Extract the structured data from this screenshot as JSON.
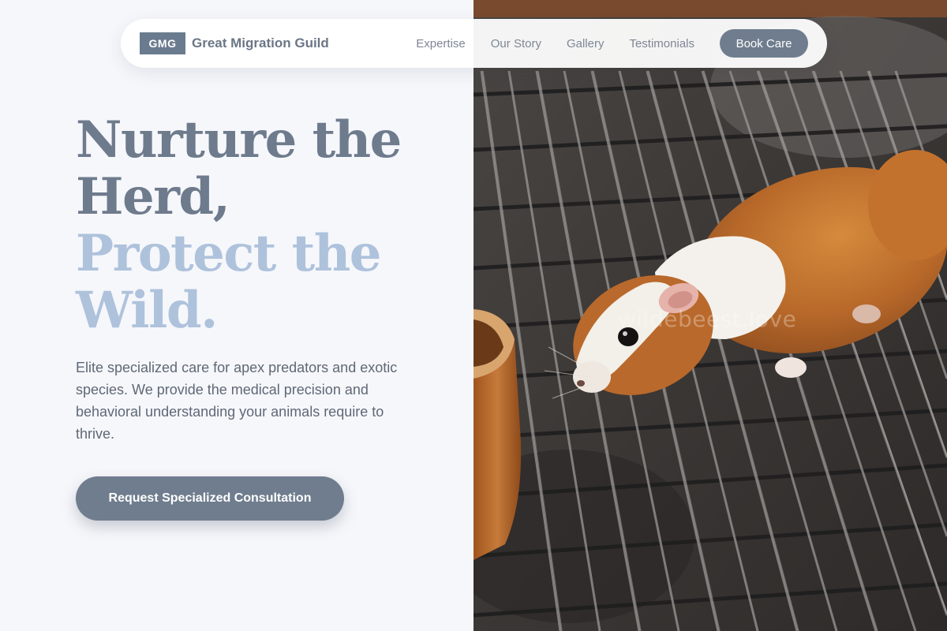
{
  "brand": {
    "logo_text": "GMG",
    "name": "Great Migration Guild"
  },
  "nav": {
    "links": [
      "Expertise",
      "Our Story",
      "Gallery",
      "Testimonials"
    ],
    "cta_label": "Book Care"
  },
  "hero": {
    "title_line1": "Nurture the",
    "title_line2": "Herd,",
    "title_line3": "Protect the",
    "title_line4": "Wild.",
    "description": "Elite specialized care for apex predators and exotic species. We provide the medical precision and behavioral understanding your animals require to thrive.",
    "cta_label": "Request Specialized Consultation"
  },
  "photo": {
    "watermark": "wildebeest.love"
  },
  "colors": {
    "accent": "#6f7d8e",
    "title_dark": "#6e7b8d",
    "title_light": "#aec2dc",
    "background": "#f6f7fb"
  }
}
